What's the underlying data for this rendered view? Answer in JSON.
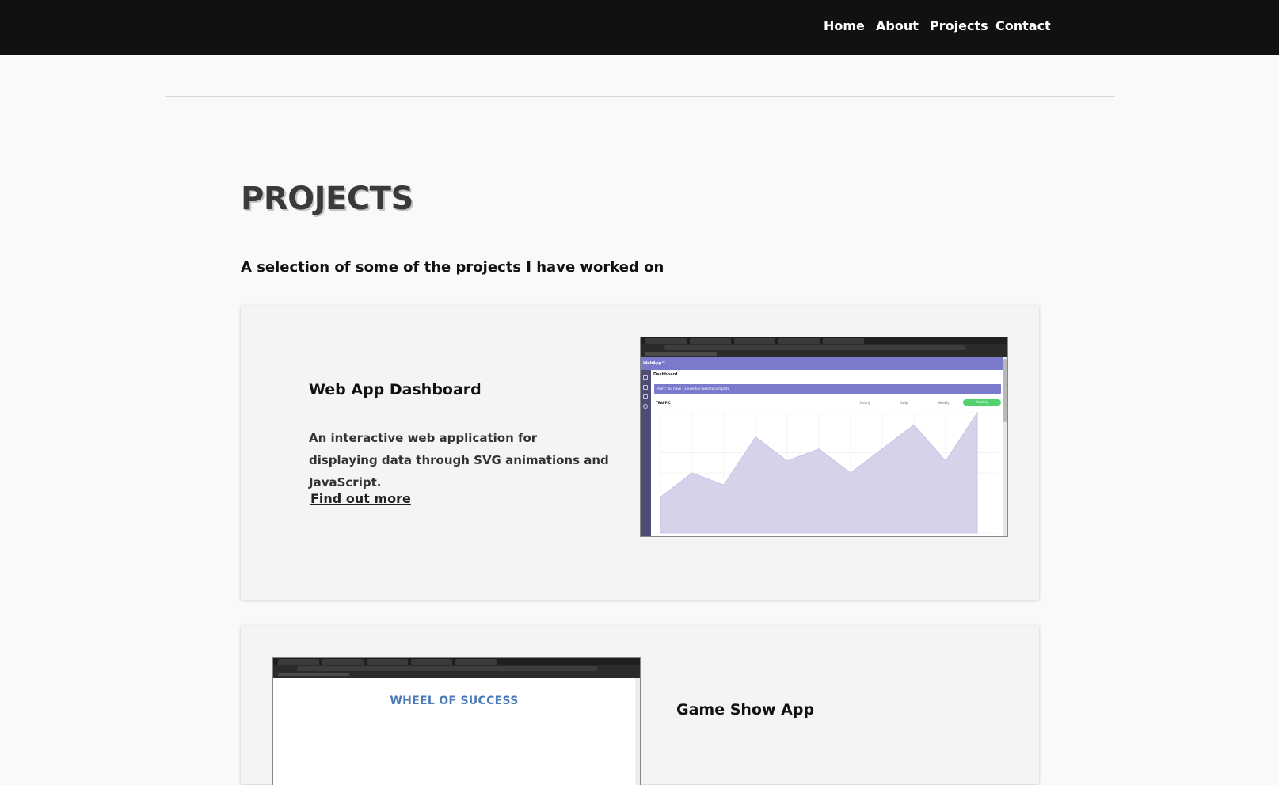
{
  "nav": {
    "links": [
      "Home",
      "About",
      "Projects",
      "Contact"
    ]
  },
  "page": {
    "title": "PROJECTS",
    "subtitle": "A selection of some of the projects I have worked on"
  },
  "projects": [
    {
      "title": "Web App Dashboard",
      "description": "An interactive web application for displaying data through SVG animations and JavaScript.",
      "link_label": "Find out more",
      "screenshot": {
        "app_name": "WebApp™",
        "section": "Dashboard",
        "alert": "Alert: You have 11 overdue tasks to complete",
        "chart_title": "TRAFFIC",
        "periods": [
          "Hourly",
          "Daily",
          "Weekly",
          "Monthly"
        ],
        "active_period": "Monthly",
        "traffic_values": [
          750,
          1250,
          1000,
          2000,
          1500,
          1750,
          1250,
          1750,
          2250,
          1500,
          2500
        ]
      }
    },
    {
      "title": "Game Show App",
      "screenshot": {
        "heading": "WHEEL OF SUCCESS"
      }
    }
  ],
  "colors": {
    "nav_bg": "#111111",
    "page_bg": "#f9f9f9",
    "card_bg": "#f4f4f4",
    "dashboard_accent": "#7a7acc",
    "active_pill": "#51d26d",
    "wheel_title": "#4a7ab8"
  }
}
